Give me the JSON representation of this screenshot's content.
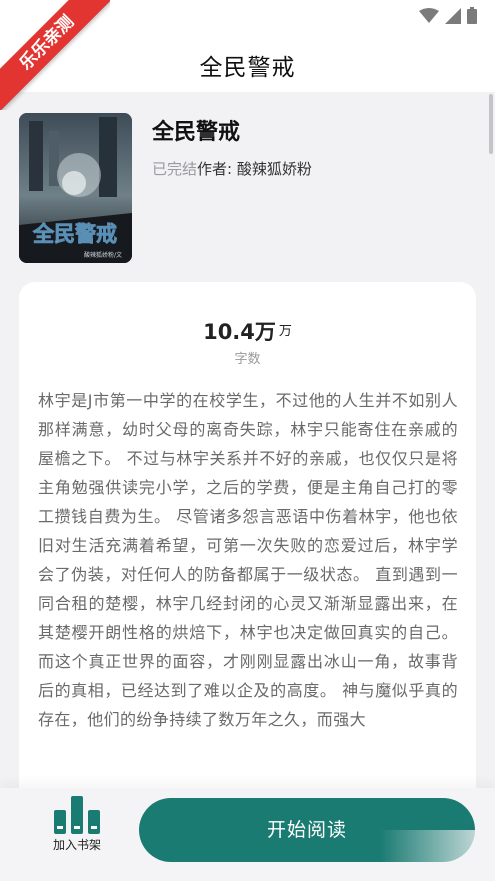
{
  "ribbon": {
    "text": "乐乐亲测"
  },
  "app_bar": {
    "title": "全民警戒"
  },
  "book": {
    "title": "全民警戒",
    "status": "已完结",
    "author": "作者: 酸辣狐娇粉",
    "cover": {
      "title": "全民警戒",
      "byline": "酸辣狐娇粉/文"
    }
  },
  "stats": {
    "word_count": "10.4万",
    "unit": "万",
    "label": "字数"
  },
  "synopsis": "林宇是J市第一中学的在校学生，不过他的人生并不如别人那样满意，幼时父母的离奇失踪，林宇只能寄住在亲戚的屋檐之下。 不过与林宇关系并不好的亲戚，也仅仅只是将主角勉强供读完小学，之后的学费，便是主角自己打的零工攒钱自费为生。 尽管诸多怨言恶语中伤着林宇，他也依旧对生活充满着希望，可第一次失败的恋爱过后，林宇学会了伪装，对任何人的防备都属于一级状态。 直到遇到一同合租的楚樱，林宇几经封闭的心灵又渐渐显露出来，在其楚樱开朗性格的烘焙下，林宇也决定做回真实的自己。 而这个真正世界的面容，才刚刚显露出冰山一角，故事背后的真相，已经达到了难以企及的高度。 神与魔似乎真的存在，他们的纷争持续了数万年之久，而强大",
  "bottom": {
    "shelf_label": "加入书架",
    "read_label": "开始阅读"
  },
  "colors": {
    "accent": "#1a7b72",
    "ribbon": "#e23532",
    "background": "#f2f2f4"
  }
}
